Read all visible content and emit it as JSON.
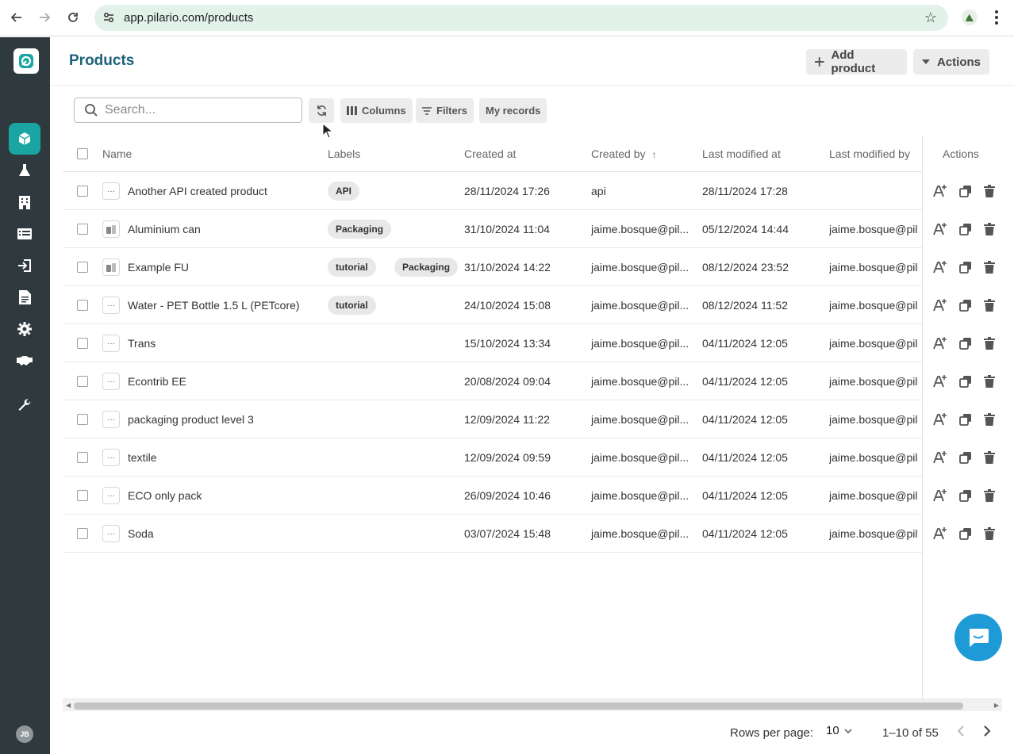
{
  "browser": {
    "url": "app.pilario.com/products"
  },
  "sidebar": {
    "items": [
      {
        "name": "products",
        "icon": "cube-icon",
        "active": true
      },
      {
        "name": "lab",
        "icon": "flask-icon",
        "active": false
      },
      {
        "name": "organizations",
        "icon": "building-icon",
        "active": false
      },
      {
        "name": "lists",
        "icon": "list-icon",
        "active": false
      },
      {
        "name": "import",
        "icon": "sign-in-icon",
        "active": false
      },
      {
        "name": "documents",
        "icon": "document-icon",
        "active": false
      },
      {
        "name": "settings",
        "icon": "gear-icon",
        "active": false
      },
      {
        "name": "partners",
        "icon": "handshake-icon",
        "active": false
      },
      {
        "name": "tools",
        "icon": "wrench-icon",
        "active": false
      }
    ],
    "avatar_initials": "JB"
  },
  "header": {
    "title": "Products",
    "add_product_label": "Add product",
    "actions_label": "Actions"
  },
  "toolbar": {
    "search_placeholder": "Search...",
    "columns_label": "Columns",
    "filters_label": "Filters",
    "my_records_label": "My records"
  },
  "table": {
    "columns": {
      "name": "Name",
      "labels": "Labels",
      "created_at": "Created at",
      "created_by": "Created by",
      "sort_indicator": "↑",
      "last_modified_at": "Last modified at",
      "last_modified_by": "Last modified by",
      "actions": "Actions"
    },
    "rows": [
      {
        "name": "Another API created product",
        "labels": [
          "API"
        ],
        "created_at": "28/11/2024 17:26",
        "created_by": "api",
        "last_modified_at": "28/11/2024 17:28",
        "last_modified_by": "",
        "thumb": "dots"
      },
      {
        "name": "Aluminium can",
        "labels": [
          "Packaging"
        ],
        "created_at": "31/10/2024 11:04",
        "created_by": "jaime.bosque@pil...",
        "last_modified_at": "05/12/2024 14:44",
        "last_modified_by": "jaime.bosque@pil",
        "thumb": "image"
      },
      {
        "name": "Example FU",
        "labels": [
          "tutorial",
          "Packaging"
        ],
        "created_at": "31/10/2024 14:22",
        "created_by": "jaime.bosque@pil...",
        "last_modified_at": "08/12/2024 23:52",
        "last_modified_by": "jaime.bosque@pil",
        "thumb": "image"
      },
      {
        "name": "Water - PET Bottle 1.5 L (PETcore)",
        "labels": [
          "tutorial"
        ],
        "created_at": "24/10/2024 15:08",
        "created_by": "jaime.bosque@pil...",
        "last_modified_at": "08/12/2024 11:52",
        "last_modified_by": "jaime.bosque@pil",
        "thumb": "dots"
      },
      {
        "name": "Trans",
        "labels": [],
        "created_at": "15/10/2024 13:34",
        "created_by": "jaime.bosque@pil...",
        "last_modified_at": "04/11/2024 12:05",
        "last_modified_by": "jaime.bosque@pil",
        "thumb": "dots"
      },
      {
        "name": "Econtrib EE",
        "labels": [],
        "created_at": "20/08/2024 09:04",
        "created_by": "jaime.bosque@pil...",
        "last_modified_at": "04/11/2024 12:05",
        "last_modified_by": "jaime.bosque@pil",
        "thumb": "dots"
      },
      {
        "name": "packaging product level 3",
        "labels": [],
        "created_at": "12/09/2024 11:22",
        "created_by": "jaime.bosque@pil...",
        "last_modified_at": "04/11/2024 12:05",
        "last_modified_by": "jaime.bosque@pil",
        "thumb": "dots"
      },
      {
        "name": "textile",
        "labels": [],
        "created_at": "12/09/2024 09:59",
        "created_by": "jaime.bosque@pil...",
        "last_modified_at": "04/11/2024 12:05",
        "last_modified_by": "jaime.bosque@pil",
        "thumb": "dots"
      },
      {
        "name": "ECO only pack",
        "labels": [],
        "created_at": "26/09/2024 10:46",
        "created_by": "jaime.bosque@pil...",
        "last_modified_at": "04/11/2024 12:05",
        "last_modified_by": "jaime.bosque@pil",
        "thumb": "dots"
      },
      {
        "name": "Soda",
        "labels": [],
        "created_at": "03/07/2024 15:48",
        "created_by": "jaime.bosque@pil...",
        "last_modified_at": "04/11/2024 12:05",
        "last_modified_by": "jaime.bosque@pil",
        "thumb": "dots"
      }
    ]
  },
  "footer": {
    "rows_per_page_label": "Rows per page:",
    "rows_per_page_value": "10",
    "range_label": "1–10 of 55"
  },
  "colors": {
    "accent": "#1aa5a3",
    "title": "#1d6279",
    "sidebar_bg": "#2f3a3e",
    "chat": "#1e9bd7"
  }
}
